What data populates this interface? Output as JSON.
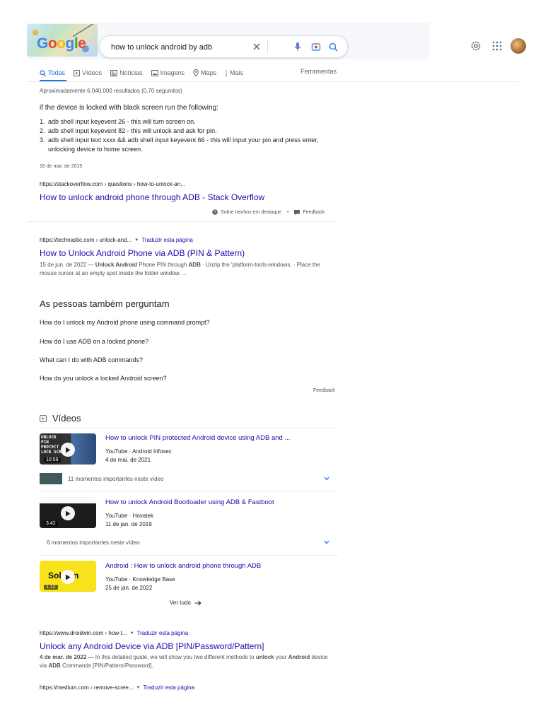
{
  "search": {
    "query": "how to unlock android by adb",
    "logo_text": "Google"
  },
  "tabs": [
    {
      "label": "Todas",
      "icon": "search-icon"
    },
    {
      "label": "Vídeos",
      "icon": "video-icon"
    },
    {
      "label": "Notícias",
      "icon": "news-icon"
    },
    {
      "label": "Imagens",
      "icon": "image-icon"
    },
    {
      "label": "Maps",
      "icon": "map-pin-icon"
    },
    {
      "label": "Mais",
      "icon": "more-vert-icon"
    }
  ],
  "tools_label": "Ferramentas",
  "stats": "Aproximadamente 6.040.000 resultados (0,70 segundos)",
  "featured": {
    "heading": "if the device is locked with black screen run the following:",
    "items": [
      {
        "n": "1.",
        "text": "adb shell input keyevent 26 - this will turn screen on."
      },
      {
        "n": "2.",
        "text": "adb shell input keyevent 82 - this will unlock and ask for pin."
      },
      {
        "n": "3.",
        "text": "adb shell input text xxxx && adb shell input keyevent 66 - this will input your pin and press enter, unlocking device to home screen."
      }
    ],
    "date": "16 de mar. de 2015",
    "url": "https://stackoverflow.com › questions › how-to-unlock-an...",
    "title": "How to unlock android phone through ADB - Stack Overflow",
    "about": "Sobre trechos em destaque",
    "dot": "•",
    "feedback": "Feedback"
  },
  "result1": {
    "url": "https://technastic.com › unlock-and...",
    "translate": "Traduzir esta página",
    "title": "How to Unlock Android Phone via ADB (PIN & Pattern)",
    "snippet_date": "15 de jun. de 2022 —",
    "snippet_b1": "Unlock Android",
    "snippet_t1": " Phone PIN through ",
    "snippet_b2": "ADB",
    "snippet_t2": " · Unzip the 'platform-tools-windows. · Place the mouse cursor at an empty spot inside the folder window. ..."
  },
  "paa": {
    "heading": "As pessoas também perguntam",
    "questions": [
      "How do I unlock my Android phone using command prompt?",
      "How do I use ADB on a locked phone?",
      "What can I do with ADB commands?",
      "How do you unlock a locked Android screen?"
    ],
    "feedback": "Feedback"
  },
  "videos": {
    "heading": "Vídeos",
    "items": [
      {
        "title": "How to unlock PIN protected Android device using ADB and ...",
        "source": "YouTube · Android Infosec",
        "date": "4 de mai. de 2021",
        "duration": "10:59",
        "thumb_text": "UNLOCK PIN PROTECT LOCK SCRE",
        "moments": "11 momentos importantes neste vídeo"
      },
      {
        "title": "How to unlock Android Bootloader using ADB & Fastboot",
        "source": "YouTube · Hovatek",
        "date": "11 de jan. de 2019",
        "duration": "3:42",
        "thumb_text": "",
        "moments": "6 momentos importantes neste vídeo"
      },
      {
        "title": "Android : How to unlock android phone through ADB",
        "source": "YouTube · Knowledge Base",
        "date": "25 de jan. de 2022",
        "duration": "1:12",
        "thumb_text": "Sol  ion",
        "moments": ""
      }
    ],
    "see_all": "Ver tudo"
  },
  "result2": {
    "url": "https://www.droidwin.com › how-t...",
    "translate": "Traduzir esta página",
    "title": "Unlock any Android Device via ADB [PIN/Password/Pattern]",
    "snippet_date": "4 de mar. de 2022 —",
    "snippet_t1": " In this detailed guide, we will show you two different methods to ",
    "snippet_b1": "unlock",
    "snippet_t2": " your ",
    "snippet_b2": "Android",
    "snippet_t3": " device via ",
    "snippet_b3": "ADB",
    "snippet_t4": " Commands [PIN/Pattern/Password]."
  },
  "result3": {
    "url": "https://medium.com › remove-scree...",
    "translate": "Traduzir esta página"
  },
  "colors": {
    "link": "#1a0dab",
    "accent": "#1a73e8",
    "text": "#202124",
    "muted": "#4d5156"
  }
}
